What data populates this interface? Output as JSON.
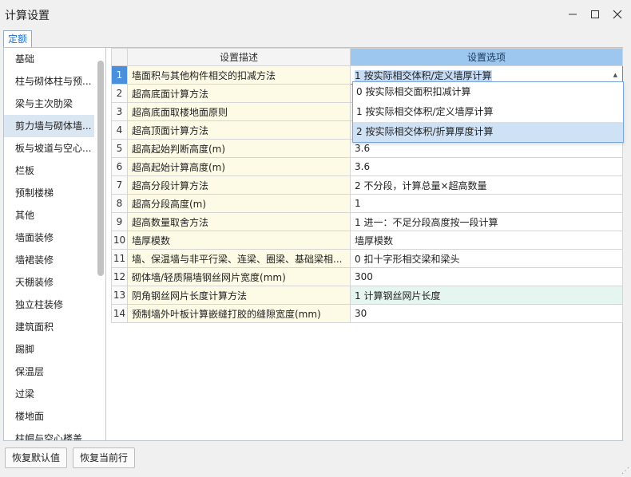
{
  "window": {
    "title": "计算设置",
    "minimize_icon": "minimize-icon",
    "maximize_icon": "maximize-icon",
    "close_icon": "close-icon"
  },
  "tabs": [
    "定额"
  ],
  "sidebar": {
    "items": [
      {
        "label": "基础"
      },
      {
        "label": "柱与砌体柱与预..."
      },
      {
        "label": "梁与主次肋梁"
      },
      {
        "label": "剪力墙与砌体墙..."
      },
      {
        "label": "板与坡道与空心..."
      },
      {
        "label": "栏板"
      },
      {
        "label": "预制楼梯"
      },
      {
        "label": "其他"
      },
      {
        "label": "墙面装修"
      },
      {
        "label": "墙裙装修"
      },
      {
        "label": "天棚装修"
      },
      {
        "label": "独立柱装修"
      },
      {
        "label": "建筑面积"
      },
      {
        "label": "踢脚"
      },
      {
        "label": "保温层"
      },
      {
        "label": "过梁"
      },
      {
        "label": "楼地面"
      },
      {
        "label": "柱帽与空心楼盖"
      }
    ],
    "active_index": 3
  },
  "table": {
    "headers": {
      "desc": "设置描述",
      "option": "设置选项"
    },
    "rows": [
      {
        "num": "1",
        "desc": "墙面积与其他构件相交的扣减方法",
        "value": "1 按实际相交体积/定义墙厚计算"
      },
      {
        "num": "2",
        "desc": "超高底面计算方法",
        "value": ""
      },
      {
        "num": "3",
        "desc": "超高底面取楼地面原则",
        "value": ""
      },
      {
        "num": "4",
        "desc": "超高顶面计算方法",
        "value": ""
      },
      {
        "num": "5",
        "desc": "超高起始判断高度(m)",
        "value": "3.6"
      },
      {
        "num": "6",
        "desc": "超高起始计算高度(m)",
        "value": "3.6"
      },
      {
        "num": "7",
        "desc": "超高分段计算方法",
        "value": "2 不分段，计算总量×超高数量"
      },
      {
        "num": "8",
        "desc": "超高分段高度(m)",
        "value": "1"
      },
      {
        "num": "9",
        "desc": "超高数量取舍方法",
        "value": "1 进一：不足分段高度按一段计算"
      },
      {
        "num": "10",
        "desc": "墙厚模数",
        "value": "墙厚模数"
      },
      {
        "num": "11",
        "desc": "墙、保温墙与非平行梁、连梁、圈梁、基础梁相...",
        "value": "0 扣十字形相交梁和梁头"
      },
      {
        "num": "12",
        "desc": "砌体墙/轻质隔墙钢丝网片宽度(mm)",
        "value": "300"
      },
      {
        "num": "13",
        "desc": "阴角钢丝网片长度计算方法",
        "value": "1 计算钢丝网片长度"
      },
      {
        "num": "14",
        "desc": "预制墙外叶板计算嵌缝打胶的缝隙宽度(mm)",
        "value": "30"
      }
    ],
    "selected_row": 1
  },
  "dropdown": {
    "options": [
      "0 按实际相交面积扣减计算",
      "1 按实际相交体积/定义墙厚计算",
      "2 按实际相交体积/折算厚度计算"
    ],
    "highlighted_index": 2
  },
  "buttons": {
    "restore_default": "恢复默认值",
    "restore_row": "恢复当前行"
  },
  "colors": {
    "accent": "#4a8fdc",
    "header_option": "#9ec7f0",
    "desc_bg": "#fdfbe6",
    "green_row": "#e5f5ef"
  }
}
